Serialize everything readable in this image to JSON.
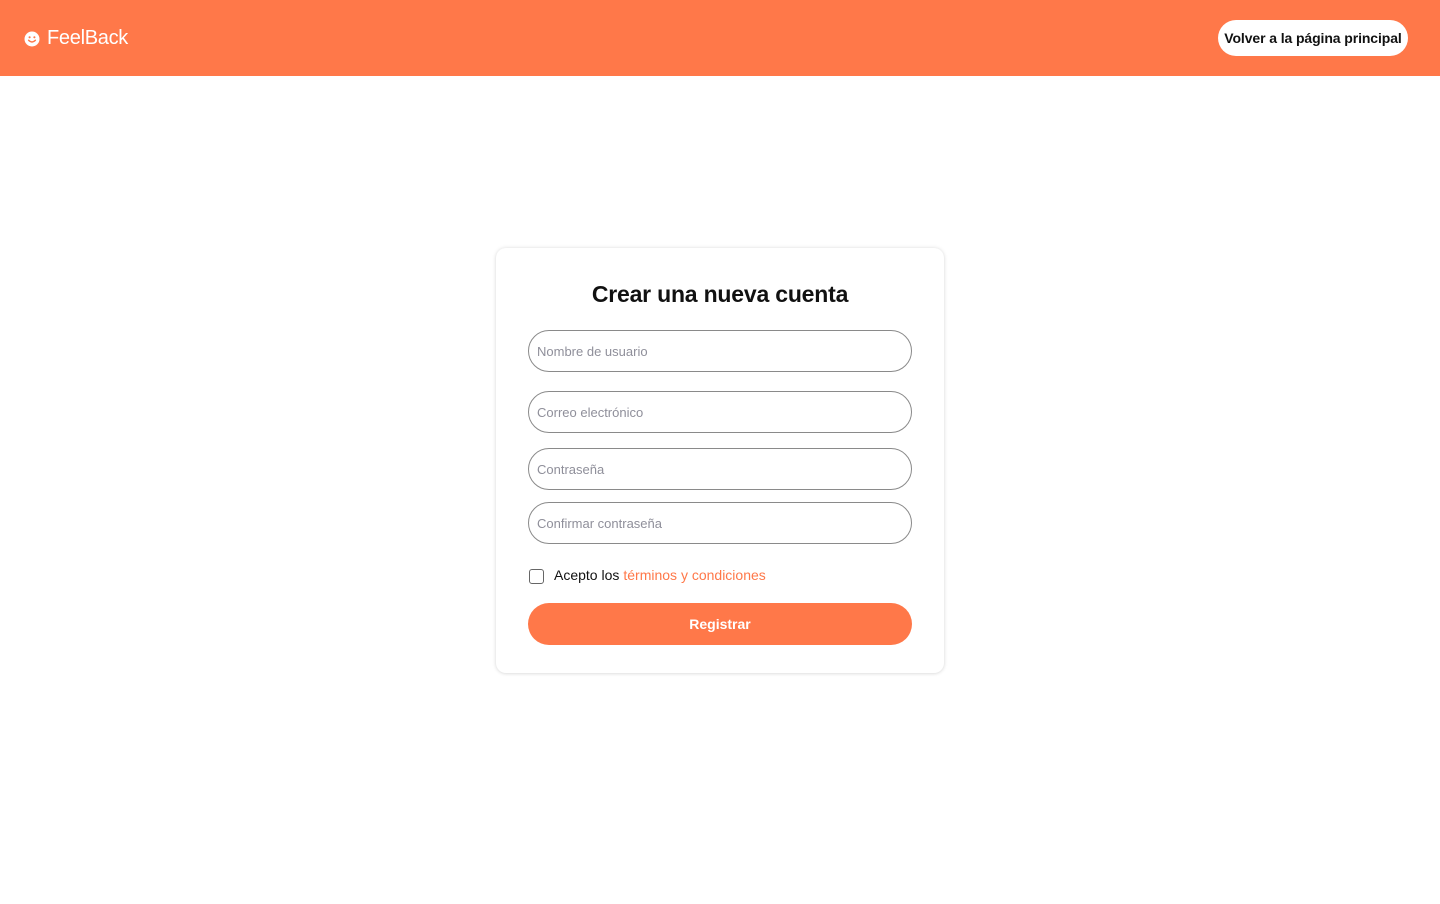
{
  "header": {
    "brand_name": "FeelBack",
    "brand_icon": "smiley-icon",
    "home_button_label": "Volver a la página principal",
    "background_color": "#ff7849"
  },
  "form": {
    "title": "Crear una nueva cuenta",
    "fields": {
      "username": {
        "placeholder": "Nombre de usuario",
        "value": ""
      },
      "email": {
        "placeholder": "Correo electrónico",
        "value": ""
      },
      "password": {
        "placeholder": "Contraseña",
        "value": ""
      },
      "confirm_password": {
        "placeholder": "Confirmar contraseña",
        "value": ""
      }
    },
    "terms": {
      "prefix": "Acepto los",
      "link_text": "términos y condiciones",
      "checked": false
    },
    "submit_label": "Registrar",
    "accent_color": "#ff7849"
  }
}
